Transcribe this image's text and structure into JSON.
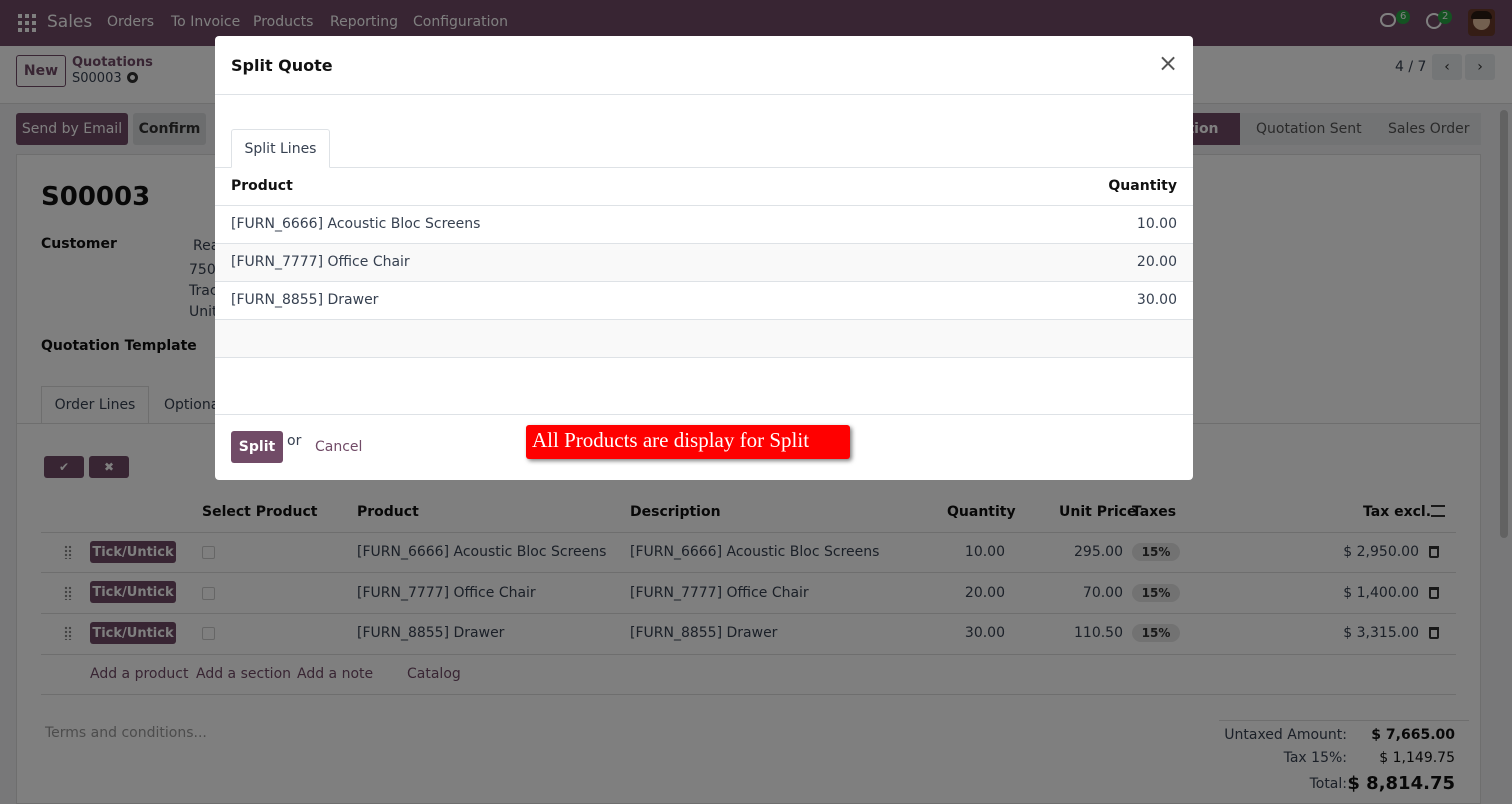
{
  "topbar": {
    "app_name": "Sales",
    "menu": [
      "Orders",
      "To Invoice",
      "Products",
      "Reporting",
      "Configuration"
    ],
    "chat_count": "6",
    "activity_count": "2"
  },
  "control": {
    "new_label": "New",
    "breadcrumb_parent": "Quotations",
    "breadcrumb_current": "S00003",
    "pager": "4 / 7"
  },
  "actions": {
    "send_email": "Send by Email",
    "confirm": "Confirm",
    "status": [
      "ation",
      "Quotation Sent",
      "Sales Order"
    ]
  },
  "form": {
    "title": "S00003",
    "customer_label": "Customer",
    "customer_lines": [
      "Rea",
      "750",
      "Trac",
      "Unit"
    ],
    "template_label": "Quotation Template",
    "tabs": [
      "Order Lines",
      "Optiona"
    ]
  },
  "order_table": {
    "headers": [
      "Select Product",
      "Product",
      "Description",
      "Quantity",
      "Unit Price",
      "Taxes",
      "Tax excl."
    ],
    "tick_label": "Tick/Untick",
    "rows": [
      {
        "product": "[FURN_6666] Acoustic Bloc Screens",
        "description": "[FURN_6666] Acoustic Bloc Screens",
        "quantity": "10.00",
        "unit_price": "295.00",
        "tax": "15%",
        "subtotal": "$ 2,950.00"
      },
      {
        "product": "[FURN_7777] Office Chair",
        "description": "[FURN_7777] Office Chair",
        "quantity": "20.00",
        "unit_price": "70.00",
        "tax": "15%",
        "subtotal": "$ 1,400.00"
      },
      {
        "product": "[FURN_8855] Drawer",
        "description": "[FURN_8855] Drawer",
        "quantity": "30.00",
        "unit_price": "110.50",
        "tax": "15%",
        "subtotal": "$ 3,315.00"
      }
    ],
    "add_links": [
      "Add a product",
      "Add a section",
      "Add a note",
      "Catalog"
    ]
  },
  "footer": {
    "terms_placeholder": "Terms and conditions...",
    "untaxed_label": "Untaxed Amount:",
    "untaxed_value": "$ 7,665.00",
    "tax_label": "Tax 15%:",
    "tax_value": "$ 1,149.75",
    "total_label": "Total:",
    "total_value": "$ 8,814.75"
  },
  "modal": {
    "title": "Split Quote",
    "tab": "Split Lines",
    "col_product": "Product",
    "col_quantity": "Quantity",
    "rows": [
      {
        "product": "[FURN_6666] Acoustic Bloc Screens",
        "quantity": "10.00"
      },
      {
        "product": "[FURN_7777] Office Chair",
        "quantity": "20.00"
      },
      {
        "product": "[FURN_8855] Drawer",
        "quantity": "30.00"
      }
    ],
    "split_label": "Split",
    "or_label": "or",
    "cancel_label": "Cancel"
  },
  "annotation": "All Products are display for Split"
}
